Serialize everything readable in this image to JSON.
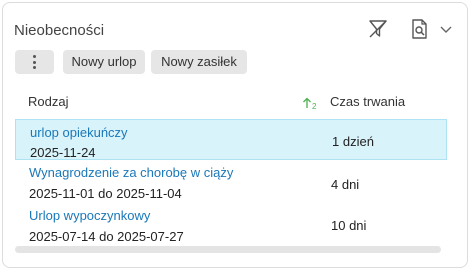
{
  "panel": {
    "title": "Nieobecności"
  },
  "header_icons": [
    "filter-icon",
    "search-document-icon",
    "chevron-down-icon"
  ],
  "toolbar": {
    "more_icon": "more-vertical-icon",
    "new_leave_label": "Nowy urlop",
    "new_allowance_label": "Nowy zasiłek"
  },
  "table": {
    "columns": {
      "type": "Rodzaj",
      "sort_indicator": "2",
      "duration": "Czas trwania"
    },
    "rows": [
      {
        "type": "urlop opiekuńczy",
        "dates": "2025-11-24",
        "duration": "1 dzień",
        "selected": true
      },
      {
        "type": "Wynagrodzenie za chorobę w ciąży",
        "dates": "2025-11-01 do 2025-11-04",
        "duration": "4 dni",
        "selected": false
      },
      {
        "type": "Urlop wypoczynkowy",
        "dates": "2025-07-14 do 2025-07-27",
        "duration": "10 dni",
        "selected": false
      }
    ]
  },
  "colors": {
    "link": "#1a78b8",
    "selected_row_bg": "#d9f3fb",
    "sort_arrow": "#4caf50"
  }
}
